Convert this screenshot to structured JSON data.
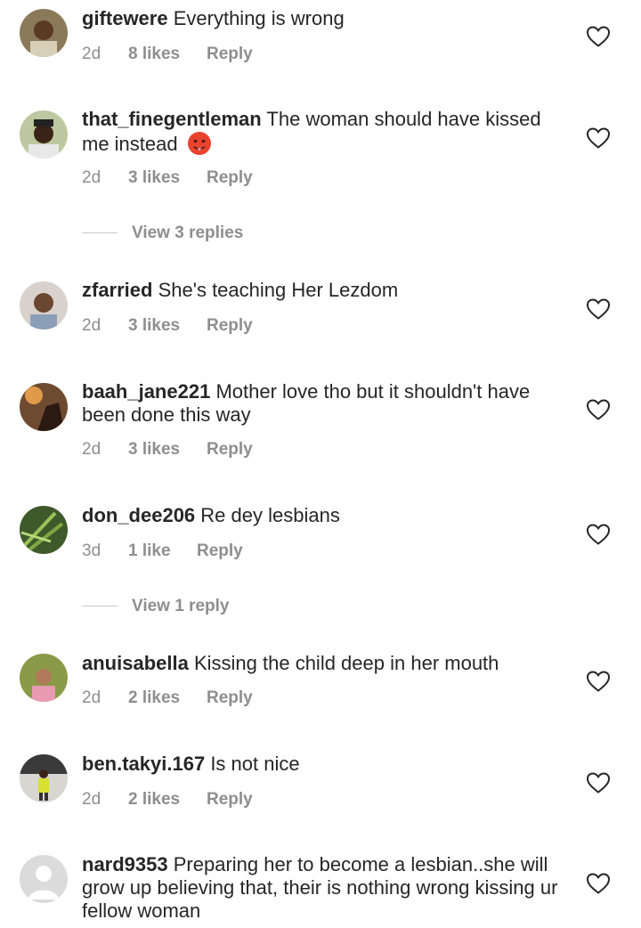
{
  "comments": [
    {
      "username": "giftewere",
      "text": "Everything is wrong",
      "time": "2d",
      "likes": "8 likes",
      "reply": "Reply",
      "avatar": "avatar-photo"
    },
    {
      "username": "that_finegentleman",
      "text": "The woman should have kissed me instead",
      "emoji": "hot-face-emoji",
      "time": "2d",
      "likes": "3 likes",
      "reply": "Reply",
      "avatar": "avatar-photo",
      "view_replies": "View 3 replies"
    },
    {
      "username": "zfarried",
      "text": "She's teaching Her Lezdom",
      "time": "2d",
      "likes": "3 likes",
      "reply": "Reply",
      "avatar": "avatar-photo"
    },
    {
      "username": "baah_jane221",
      "text": "Mother love tho but it shouldn't have been done this way",
      "time": "2d",
      "likes": "3 likes",
      "reply": "Reply",
      "avatar": "avatar-photo"
    },
    {
      "username": "don_dee206",
      "text": "Re dey lesbians",
      "time": "3d",
      "likes": "1 like",
      "reply": "Reply",
      "avatar": "avatar-photo",
      "view_replies": "View 1 reply"
    },
    {
      "username": "anuisabella",
      "text": "Kissing the child deep in her mouth",
      "time": "2d",
      "likes": "2 likes",
      "reply": "Reply",
      "avatar": "avatar-photo"
    },
    {
      "username": "ben.takyi.167",
      "text": "Is not nice",
      "time": "2d",
      "likes": "2 likes",
      "reply": "Reply",
      "avatar": "avatar-photo"
    },
    {
      "username": "nard9353",
      "text": "Preparing her to become a lesbian..she will grow up believing that, their is nothing wrong kissing ur fellow woman",
      "avatar": "default-avatar"
    }
  ],
  "icons": {
    "like": "heart-icon"
  },
  "colors": {
    "text": "#262626",
    "meta": "#8e8e8e",
    "divider": "#c7c7c7"
  }
}
